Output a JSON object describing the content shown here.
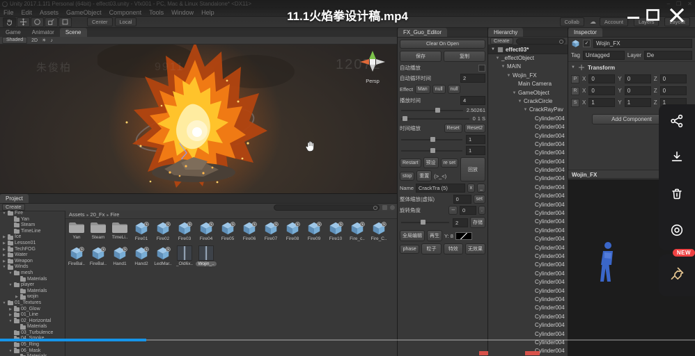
{
  "player": {
    "title": "11.1火焰拳设计稿.mp4",
    "progress_pct": 21,
    "accent_blue": "#1694e8",
    "sidebar": {
      "icons": [
        "share-icon",
        "download-icon",
        "trash-icon",
        "record-icon",
        "pin-icon"
      ],
      "badge": "NEW",
      "badge_color": "#ef4143",
      "pin_color": "#e9c892"
    }
  },
  "unity": {
    "titlebar": "Unity 2017.1.1f1 Personal (64bit) - effect03.unity - Vfx001 - PC, Mac & Linux Standalone* <DX11>",
    "win_controls": [
      "–",
      "❐",
      "✕"
    ],
    "menus": [
      "File",
      "Edit",
      "Assets",
      "GameObject",
      "Component",
      "Tools",
      "Window",
      "Help"
    ],
    "toolbar": {
      "pivot": "Center",
      "space": "Local",
      "collab": "Collab",
      "account": "Account",
      "layers": "Layers",
      "layout": "Layout"
    },
    "scene": {
      "tabs": [
        {
          "label": "Game",
          "cls": ""
        },
        {
          "label": "Animator",
          "cls": ""
        },
        {
          "label": "Scene",
          "cls": "active"
        }
      ],
      "shaded": "Shaded",
      "toggles": [
        "2D",
        "☀",
        "♪"
      ],
      "persp": "Persp",
      "watermarks": [
        {
          "text": "朱俊柏",
          "cls": "wm-a"
        },
        {
          "text": "9911",
          "cls": "wm-b"
        },
        {
          "text": "12072",
          "cls": "wm-c"
        }
      ]
    },
    "fx": {
      "tab": "FX_Guo_Editor",
      "clear": "Clear On Open",
      "save": "保存",
      "copy": "复制",
      "auto_play": "自动播放",
      "loop_time_label": "自动循环时间",
      "loop_time": "2",
      "effect_label": "Effect",
      "effect_btns": [
        "Man",
        "null",
        "null"
      ],
      "play_time_label": "播放时间",
      "play_time": "4",
      "slider1_val": "2.50261",
      "slider2_a": "0",
      "slider2_b": "1 S",
      "scale_label": "时间缩放",
      "reset1": "Reset",
      "reset2": "Reset2",
      "slider3_val": "1",
      "slider4_val": "1",
      "btn_restart": "Restart",
      "btn_preset": "预设",
      "btn_reset": "re set",
      "btn_reset_cn": "重置",
      "btn_replay": "回放",
      "btn_stop": "stop",
      "face": "(>_<)",
      "name_label": "Name",
      "name_val": "CrackTra (5)",
      "btn_x": "x",
      "btn_u": "_",
      "overall_label": "整体缩放(虚拟)",
      "overall_val": "0",
      "btn_set": "set",
      "rotate_label": "旋转角度",
      "btn_minus": "--",
      "rotate_val": "0",
      "btn_dot": ".",
      "slider5_val": "2",
      "btn_store": "存储",
      "btn_global": "全局编辑",
      "btn_regen": "再生",
      "y_label": "Y: 8",
      "bottom_btns": [
        "phase",
        "粒子",
        "特效",
        "无效果"
      ]
    },
    "hierarchy": {
      "tab": "Hierarchy",
      "create": "Create",
      "scene_row": "effect03*",
      "items": [
        {
          "label": "_effectObject",
          "depth": "d1",
          "color": "",
          "arrow": "▼"
        },
        {
          "label": "MAIN",
          "depth": "d2",
          "color": "",
          "arrow": "▼"
        },
        {
          "label": "Wojin_FX",
          "depth": "d3",
          "color": "blue",
          "arrow": "▼"
        },
        {
          "label": "Main Camera",
          "depth": "d4",
          "color": "blue",
          "arrow": ""
        },
        {
          "label": "GameObject",
          "depth": "d4",
          "color": "blue",
          "arrow": "▼"
        },
        {
          "label": "CrackCircle",
          "depth": "d5",
          "color": "blue",
          "arrow": "▼"
        },
        {
          "label": "CrackRayPav",
          "depth": "d6",
          "color": "blue",
          "arrow": "▼"
        },
        {
          "label": "Cylinder004",
          "depth": "d7",
          "color": "blue",
          "arrow": ""
        },
        {
          "label": "Cylinder004",
          "depth": "d7",
          "color": "blue",
          "arrow": ""
        },
        {
          "label": "Cylinder004",
          "depth": "d7",
          "color": "blue",
          "arrow": ""
        },
        {
          "label": "Cylinder004",
          "depth": "d7",
          "color": "blue",
          "arrow": ""
        },
        {
          "label": "Cylinder004",
          "depth": "d7",
          "color": "blue",
          "arrow": ""
        },
        {
          "label": "Cylinder004",
          "depth": "d7",
          "color": "blue",
          "arrow": ""
        },
        {
          "label": "Cylinder004",
          "depth": "d7",
          "color": "blue",
          "arrow": ""
        },
        {
          "label": "Cylinder004",
          "depth": "d7",
          "color": "blue",
          "arrow": ""
        },
        {
          "label": "Cylinder004",
          "depth": "d7",
          "color": "blue",
          "arrow": ""
        },
        {
          "label": "Cylinder004",
          "depth": "d7",
          "color": "blue",
          "arrow": ""
        },
        {
          "label": "Cylinder004",
          "depth": "d7",
          "color": "blue",
          "arrow": ""
        },
        {
          "label": "Cylinder004",
          "depth": "d7",
          "color": "blue",
          "arrow": ""
        },
        {
          "label": "Cylinder004",
          "depth": "d7",
          "color": "blue",
          "arrow": ""
        },
        {
          "label": "Cylinder004",
          "depth": "d7",
          "color": "blue",
          "arrow": ""
        },
        {
          "label": "Cylinder004",
          "depth": "d7",
          "color": "blue",
          "arrow": ""
        },
        {
          "label": "Cylinder004",
          "depth": "d7",
          "color": "blue",
          "arrow": ""
        },
        {
          "label": "Cylinder004",
          "depth": "d7",
          "color": "blue",
          "arrow": ""
        },
        {
          "label": "Cylinder004",
          "depth": "d7",
          "color": "blue",
          "arrow": ""
        },
        {
          "label": "Cylinder004",
          "depth": "d7",
          "color": "blue",
          "arrow": ""
        },
        {
          "label": "Cylinder004",
          "depth": "d7",
          "color": "blue",
          "arrow": ""
        },
        {
          "label": "Cylinder004",
          "depth": "d7",
          "color": "blue",
          "arrow": ""
        },
        {
          "label": "Cylinder004",
          "depth": "d7",
          "color": "blue",
          "arrow": ""
        },
        {
          "label": "Cylinder004",
          "depth": "d7",
          "color": "blue",
          "arrow": ""
        },
        {
          "label": "Cylinder004",
          "depth": "d7",
          "color": "blue",
          "arrow": ""
        },
        {
          "label": "Cylinder004",
          "depth": "d7",
          "color": "blue",
          "arrow": ""
        },
        {
          "label": "Cylinder004",
          "depth": "d7",
          "color": "blue",
          "arrow": ""
        },
        {
          "label": "Cylinder004",
          "depth": "d7",
          "color": "blue",
          "arrow": ""
        },
        {
          "label": "Cylinder004",
          "depth": "d7",
          "color": "blue",
          "arrow": ""
        }
      ]
    },
    "inspector": {
      "tab": "Inspector",
      "name": "Wojin_FX",
      "tag_label": "Tag",
      "tag": "Untagged",
      "layer_label": "Layer",
      "layer": "De",
      "transform": "Transform",
      "rows": [
        {
          "k": "P",
          "xl": "X",
          "x": "0",
          "yl": "Y",
          "y": "0",
          "zl": "Z",
          "z": "0"
        },
        {
          "k": "R",
          "xl": "X",
          "x": "0",
          "yl": "Y",
          "y": "0",
          "zl": "Z",
          "z": "0"
        },
        {
          "k": "S",
          "xl": "X",
          "x": "1",
          "yl": "Y",
          "y": "1",
          "zl": "Z",
          "z": "1"
        }
      ],
      "add_component": "Add Component",
      "preview_title": "Wojin_FX"
    },
    "project": {
      "tab": "Project",
      "create": "Create",
      "breadcrumb": [
        "Assets",
        "20_Fx",
        "Fire"
      ],
      "tree": [
        {
          "label": "Fire",
          "depth": "p0",
          "arrow": "▼"
        },
        {
          "label": "Yan",
          "depth": "p1",
          "arrow": ""
        },
        {
          "label": "Steam",
          "depth": "p1",
          "arrow": ""
        },
        {
          "label": "TimeLine",
          "depth": "p1",
          "arrow": ""
        },
        {
          "label": "Ice",
          "depth": "p0",
          "arrow": "▶"
        },
        {
          "label": "Lesson01",
          "depth": "p0",
          "arrow": "▶"
        },
        {
          "label": "TechFOG",
          "depth": "p0",
          "arrow": "▶"
        },
        {
          "label": "Water",
          "depth": "p0",
          "arrow": "▶"
        },
        {
          "label": "Weapon",
          "depth": "p0",
          "arrow": "▶"
        },
        {
          "label": "Winds",
          "depth": "p0",
          "arrow": "▼"
        },
        {
          "label": "mesh",
          "depth": "p1",
          "arrow": "▼"
        },
        {
          "label": "Materials",
          "depth": "p2",
          "arrow": ""
        },
        {
          "label": "player",
          "depth": "p1",
          "arrow": "▼"
        },
        {
          "label": "Materials",
          "depth": "p2",
          "arrow": ""
        },
        {
          "label": "wojin",
          "depth": "p2",
          "arrow": "▶"
        },
        {
          "label": "01_Textures",
          "depth": "p0",
          "arrow": "▼"
        },
        {
          "label": "00_Glow",
          "depth": "p1",
          "arrow": "▶"
        },
        {
          "label": "01_Line",
          "depth": "p1",
          "arrow": "▶"
        },
        {
          "label": "02_Horizontal",
          "depth": "p1",
          "arrow": "▼"
        },
        {
          "label": "Materials",
          "depth": "p2",
          "arrow": ""
        },
        {
          "label": "03_Turbulence",
          "depth": "p1",
          "arrow": ""
        },
        {
          "label": "04_Smoke",
          "depth": "p1",
          "arrow": ""
        },
        {
          "label": "05_Ring",
          "depth": "p1",
          "arrow": ""
        },
        {
          "label": "06_Mask",
          "depth": "p1",
          "arrow": "▼"
        },
        {
          "label": "Materials",
          "depth": "p2",
          "arrow": ""
        }
      ],
      "assets": [
        {
          "label": "Yan",
          "type": "folder",
          "sel": ""
        },
        {
          "label": "Steam",
          "type": "folder",
          "sel": ""
        },
        {
          "label": "TimeLi..",
          "type": "folder",
          "sel": ""
        },
        {
          "label": "Fire01",
          "type": "cube",
          "sel": ""
        },
        {
          "label": "Fire02",
          "type": "cube",
          "sel": ""
        },
        {
          "label": "Fire03",
          "type": "cube",
          "sel": ""
        },
        {
          "label": "Fire04",
          "type": "cube",
          "sel": ""
        },
        {
          "label": "Fire05",
          "type": "cube",
          "sel": ""
        },
        {
          "label": "Fire06",
          "type": "cube",
          "sel": ""
        },
        {
          "label": "Fire07",
          "type": "cube",
          "sel": ""
        },
        {
          "label": "Fire08",
          "type": "cube",
          "sel": ""
        },
        {
          "label": "Fire09",
          "type": "cube",
          "sel": ""
        },
        {
          "label": "Fire10",
          "type": "cube",
          "sel": ""
        },
        {
          "label": "Fire_c..",
          "type": "cube",
          "sel": ""
        },
        {
          "label": "Fire_C..",
          "type": "cube",
          "sel": ""
        },
        {
          "label": "FireBal..",
          "type": "cube",
          "sel": ""
        },
        {
          "label": "FireBal..",
          "type": "cube",
          "sel": ""
        },
        {
          "label": "Hand1",
          "type": "cube",
          "sel": ""
        },
        {
          "label": "Hand2",
          "type": "cube",
          "sel": ""
        },
        {
          "label": "LedMar..",
          "type": "cube",
          "sel": ""
        },
        {
          "label": "_Old6x..",
          "type": "mat",
          "sel": ""
        },
        {
          "label": "Wojin_..",
          "type": "mat",
          "sel": "selected"
        }
      ]
    }
  }
}
